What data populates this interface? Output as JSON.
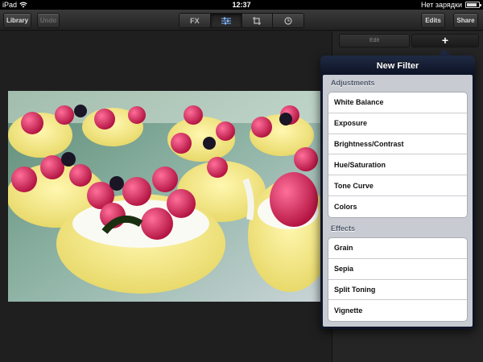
{
  "statusbar": {
    "device": "iPad",
    "time": "12:37",
    "charging": "Нет зарядки",
    "battery_level": 0.85
  },
  "toolbar": {
    "library_label": "Library",
    "undo_label": "Undo",
    "edits_label": "Edits",
    "share_label": "Share",
    "segments": [
      {
        "label": "FX",
        "icon": ""
      },
      {
        "label": "",
        "icon": "sliders-icon"
      },
      {
        "label": "",
        "icon": "crop-icon"
      },
      {
        "label": "",
        "icon": "clock-icon"
      }
    ],
    "active_segment": 1
  },
  "panel": {
    "edit_tab": "Edit",
    "add_tab": "+"
  },
  "popover": {
    "title": "New Filter",
    "sections": [
      {
        "header": "Adjustments",
        "items": [
          "White Balance",
          "Exposure",
          "Brightness/Contrast",
          "Hue/Saturation",
          "Tone Curve",
          "Colors"
        ]
      },
      {
        "header": "Effects",
        "items": [
          "Grain",
          "Sepia",
          "Split Toning",
          "Vignette"
        ]
      }
    ]
  },
  "colors": {
    "accent": "#7fb6ff",
    "popover_header": "#1f2a44",
    "list_bg": "#c8ccd2"
  }
}
